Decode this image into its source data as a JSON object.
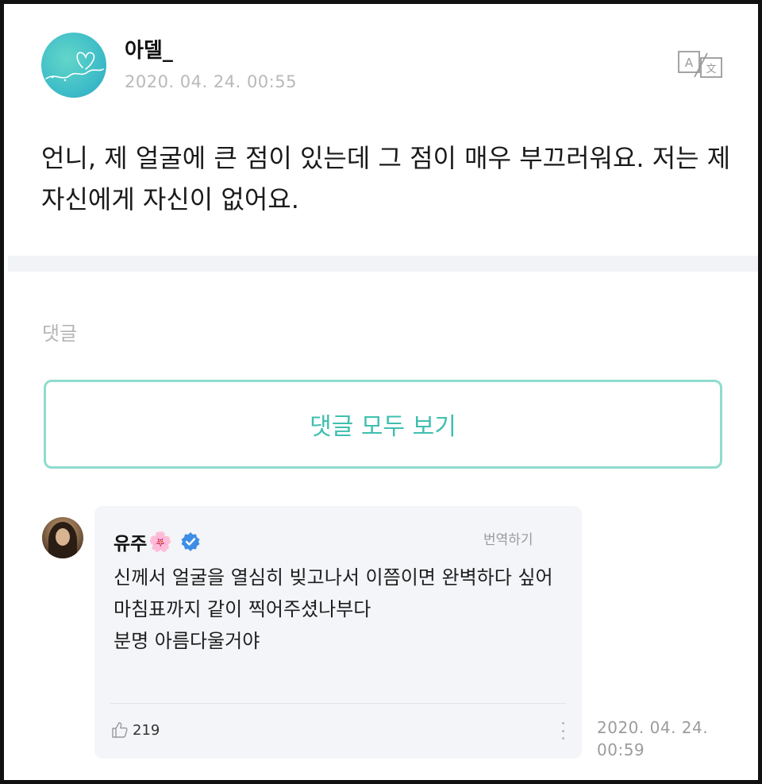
{
  "post": {
    "author": "아델_",
    "timestamp": "2020. 04. 24. 00:55",
    "body": "언니, 제 얼굴에 큰 점이 있는데 그 점이 매우 부끄러워요. 저는 제 자신에게 자신이 없어요.",
    "avatar_icon": "heart-line-icon",
    "translate_icon": "translate-icon"
  },
  "comments_section": {
    "heading": "댓글",
    "view_all_label": "댓글 모두 보기"
  },
  "comment": {
    "author": "유주",
    "author_emoji": "🌸",
    "verified_icon": "verified-check-icon",
    "translate_label": "번역하기",
    "text": "신께서 얼굴을 열심히 빚고나서 이쯤이면 완벽하다 싶어 마침표까지 같이 찍어주셨나부다\n분명 아름다울거야",
    "likes": "219",
    "timestamp_date": "2020. 04. 24.",
    "timestamp_time": "00:59"
  },
  "colors": {
    "accent": "#3fbfb0",
    "accent_border": "#8fdccf",
    "card_bg": "#f3f5f8",
    "muted_text": "#b5b5b5"
  }
}
